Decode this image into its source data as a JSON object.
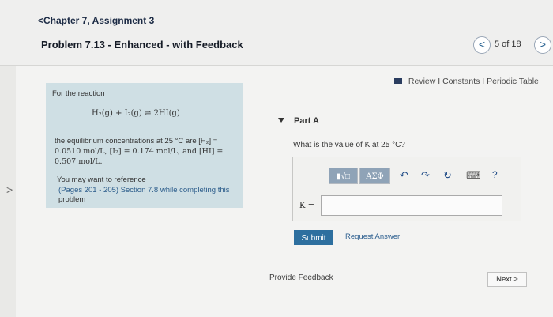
{
  "header": {
    "back_label": "<Chapter 7, Assignment 3",
    "title": "Problem 7.13 - Enhanced - with Feedback",
    "prev_symbol": "<",
    "page_count": "5 of 18",
    "next_symbol": ">"
  },
  "side_nav": {
    "chevron": ">"
  },
  "resources": {
    "text": "Review I Constants I Periodic Table"
  },
  "problem": {
    "intro": "For the reaction",
    "reaction": "H₂(g) + I₂(g) ⇌ 2HI(g)",
    "line1": "the equilibrium concentrations at 25 °C are [H₂] =",
    "line2": "0.0510 mol/L, [I₂] = 0.174 mol/L, and [HI] =",
    "line3": "0.507 mol/L.",
    "reference_line1": "You may want to reference",
    "reference_line2": "(Pages 201 - 205) Section 7.8 while completing this",
    "reference_line3": "problem"
  },
  "part": {
    "label": "Part A",
    "question": "What is the value of K at 25 °C?",
    "toolbar": {
      "template_label": "▮√□",
      "greek_label": "ΑΣΦ",
      "undo_icon": "↶",
      "redo_icon": "↷",
      "reset_icon": "↻",
      "keyboard_icon": "⌨",
      "help_icon": "?"
    },
    "answer_label": "K =",
    "answer_value": ""
  },
  "actions": {
    "submit": "Submit",
    "request_answer": "Request Answer",
    "feedback": "Provide Feedback",
    "next": "Next >"
  }
}
